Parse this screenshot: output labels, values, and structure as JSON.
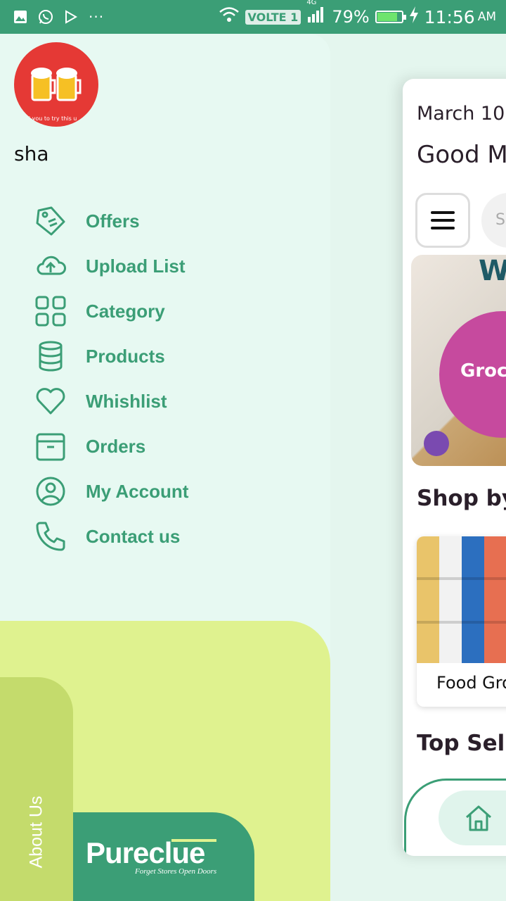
{
  "status_bar": {
    "network": "VOLTE 1",
    "net_type": "4G",
    "battery": "79%",
    "battery_level": 0.79,
    "time": "11:56",
    "ampm": "AM"
  },
  "drawer": {
    "avatar_caption": "d you to try this u",
    "user_name": "sha",
    "menu": [
      {
        "label": "Offers",
        "icon": "tag-icon"
      },
      {
        "label": "Upload List",
        "icon": "cloud-upload-icon"
      },
      {
        "label": "Category",
        "icon": "grid-icon"
      },
      {
        "label": "Products",
        "icon": "database-icon"
      },
      {
        "label": "Whishlist",
        "icon": "heart-icon"
      },
      {
        "label": "Orders",
        "icon": "box-icon"
      },
      {
        "label": "My Account",
        "icon": "user-circle-icon"
      },
      {
        "label": "Contact us",
        "icon": "phone-icon"
      }
    ],
    "about_label": "About Us",
    "brand_name": "Pureclue",
    "brand_tagline": "Forget Stores Open Doors"
  },
  "main": {
    "date": "March 10,",
    "greeting": "Good M",
    "search_placeholder": "Se",
    "banner_top": "We",
    "banner_text": "Groc",
    "shop_by_title": "Shop by",
    "category_label": "Food Gro",
    "top_selling_title": "Top Sellin"
  },
  "colors": {
    "primary": "#3b9e76",
    "drawer_bg": "#e7f9f2",
    "lime": "#dff28f",
    "about_tab": "#c4db6c"
  }
}
